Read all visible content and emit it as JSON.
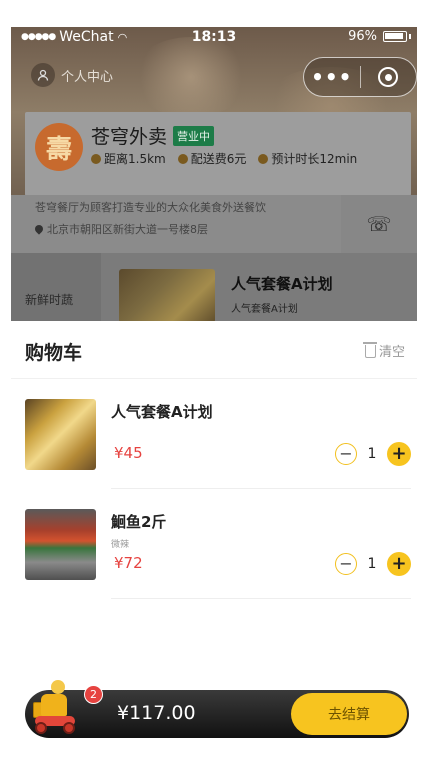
{
  "status_bar": {
    "carrier": "WeChat",
    "time": "18:13",
    "battery": "96%"
  },
  "header": {
    "user_center_label": "个人中心",
    "more_icon": "more-dots-icon",
    "close_icon": "target-circle-icon"
  },
  "shop": {
    "logo_text": "壽",
    "name": "苍穹外卖",
    "status_badge": "营业中",
    "distance": "距离1.5km",
    "delivery_fee": "配送费6元",
    "eta": "预计时长12min",
    "intro": "苍穹餐厅为顾客打造专业的大众化美食外送餐饮",
    "address": "北京市朝阳区新街大道一号楼8层",
    "phone_icon": "phone-icon"
  },
  "menu_background": {
    "category": "新鲜时蔬",
    "dish_name": "人气套餐A计划",
    "dish_desc": "人气套餐A计划"
  },
  "cart": {
    "title": "购物车",
    "clear_label": "清空",
    "items": [
      {
        "name": "人气套餐A计划",
        "spec": "",
        "price": "¥45",
        "quantity": "1"
      },
      {
        "name": "鮰鱼2斤",
        "spec": "微辣",
        "price": "¥72",
        "quantity": "1"
      }
    ]
  },
  "bottom_bar": {
    "badge_count": "2",
    "total": "¥117.00",
    "checkout_label": "去结算"
  },
  "colors": {
    "accent_yellow": "#f7c41f",
    "price_red": "#e64340",
    "open_green": "#1d7c48"
  }
}
